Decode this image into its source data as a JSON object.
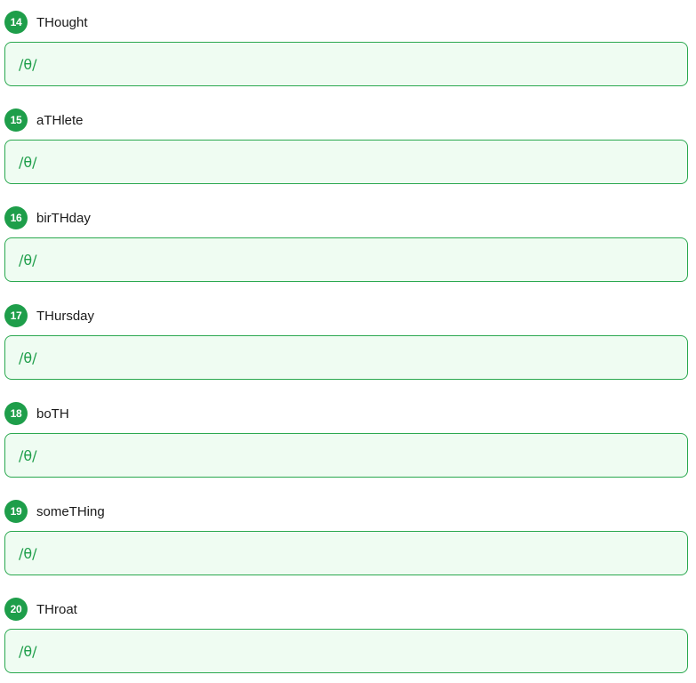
{
  "items": [
    {
      "number": "14",
      "word": "THought",
      "answer": "/θ/"
    },
    {
      "number": "15",
      "word": "aTHlete",
      "answer": "/θ/"
    },
    {
      "number": "16",
      "word": "birTHday",
      "answer": "/θ/"
    },
    {
      "number": "17",
      "word": "THursday",
      "answer": "/θ/"
    },
    {
      "number": "18",
      "word": "boTH",
      "answer": "/θ/"
    },
    {
      "number": "19",
      "word": "someTHing",
      "answer": "/θ/"
    },
    {
      "number": "20",
      "word": "THroat",
      "answer": "/θ/"
    }
  ],
  "colors": {
    "accent": "#1e9e4a",
    "answer_background": "#effcf2",
    "answer_border": "#2aa84f"
  }
}
